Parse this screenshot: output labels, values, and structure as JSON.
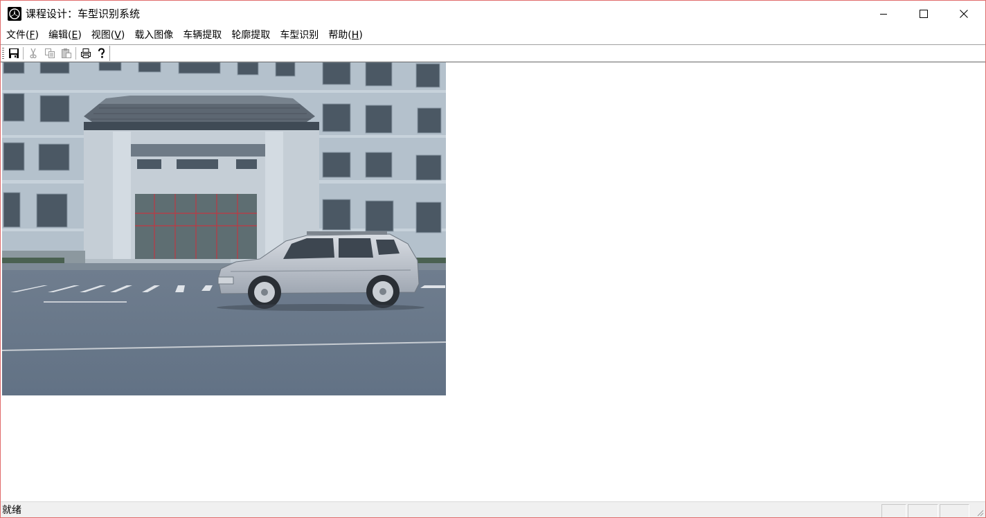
{
  "window": {
    "title": "课程设计：车型识别系统",
    "controls": {
      "minimize": "minimize-icon",
      "maximize": "maximize-icon",
      "close": "close-icon"
    }
  },
  "menubar": {
    "file": {
      "label": "文件(",
      "mnemonic": "F",
      "tail": ")"
    },
    "edit": {
      "label": "编辑(",
      "mnemonic": "E",
      "tail": ")"
    },
    "view": {
      "label": "视图(",
      "mnemonic": "V",
      "tail": ")"
    },
    "load_image": "载入图像",
    "vehicle_extract": "车辆提取",
    "contour_extract": "轮廓提取",
    "model_recognition": "车型识别",
    "help": {
      "label": "帮助(",
      "mnemonic": "H",
      "tail": ")"
    }
  },
  "toolbar": {
    "buttons": [
      "save-icon",
      "cut-icon",
      "copy-icon",
      "paste-icon",
      "print-icon",
      "help-icon"
    ],
    "disabled": [
      "cut-icon",
      "copy-icon",
      "paste-icon"
    ]
  },
  "content": {
    "image": "photo of a silver SUV driving in front of a building with a traditional Chinese-style roofed entrance"
  },
  "statusbar": {
    "text": "就绪"
  },
  "colors": {
    "window_border": "#e06b6b",
    "statusbar_bg": "#f0f0f0"
  }
}
